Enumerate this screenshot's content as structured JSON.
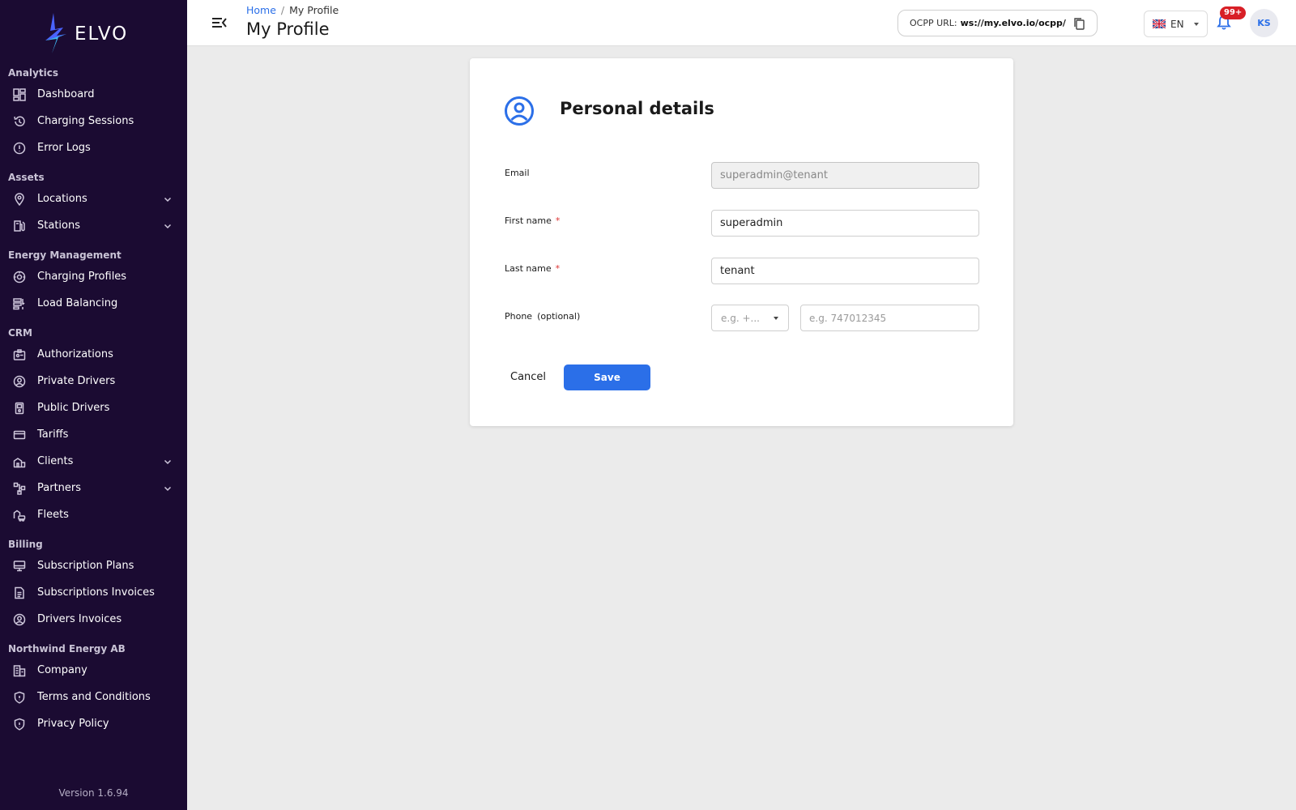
{
  "brand": {
    "name": "ELVO",
    "accent": "#2b6fe8",
    "sidebar_bg": "#1b0b32"
  },
  "sidebar": {
    "sections": [
      {
        "title": "Analytics",
        "items": [
          {
            "label": "Dashboard",
            "icon": "dashboard-icon",
            "expandable": false
          },
          {
            "label": "Charging Sessions",
            "icon": "history-icon",
            "expandable": false
          },
          {
            "label": "Error Logs",
            "icon": "alert-circle-icon",
            "expandable": false
          }
        ]
      },
      {
        "title": "Assets",
        "items": [
          {
            "label": "Locations",
            "icon": "map-pin-icon",
            "expandable": true
          },
          {
            "label": "Stations",
            "icon": "station-icon",
            "expandable": true
          }
        ]
      },
      {
        "title": "Energy Management",
        "items": [
          {
            "label": "Charging Profiles",
            "icon": "gauge-icon",
            "expandable": false
          },
          {
            "label": "Load Balancing",
            "icon": "balance-icon",
            "expandable": false
          }
        ]
      },
      {
        "title": "CRM",
        "items": [
          {
            "label": "Authorizations",
            "icon": "badge-icon",
            "expandable": false
          },
          {
            "label": "Private Drivers",
            "icon": "user-circle-icon",
            "expandable": false
          },
          {
            "label": "Public Drivers",
            "icon": "device-icon",
            "expandable": false
          },
          {
            "label": "Tariffs",
            "icon": "card-icon",
            "expandable": false
          },
          {
            "label": "Clients",
            "icon": "building-icon",
            "expandable": true
          },
          {
            "label": "Partners",
            "icon": "network-icon",
            "expandable": true
          },
          {
            "label": "Fleets",
            "icon": "fleet-icon",
            "expandable": false
          }
        ]
      },
      {
        "title": "Billing",
        "items": [
          {
            "label": "Subscription Plans",
            "icon": "monitor-icon",
            "expandable": false
          },
          {
            "label": "Subscriptions Invoices",
            "icon": "document-icon",
            "expandable": false
          },
          {
            "label": "Drivers Invoices",
            "icon": "user-circle-icon",
            "expandable": false
          }
        ]
      },
      {
        "title": "Northwind Energy AB",
        "items": [
          {
            "label": "Company",
            "icon": "office-icon",
            "expandable": false
          },
          {
            "label": "Terms and Conditions",
            "icon": "shield-icon",
            "expandable": false
          },
          {
            "label": "Privacy Policy",
            "icon": "shield-icon",
            "expandable": false
          }
        ]
      }
    ],
    "version": "Version 1.6.94"
  },
  "header": {
    "breadcrumb": {
      "home": "Home",
      "separator": "/",
      "current": "My Profile"
    },
    "title": "My Profile",
    "ocpp_label": "OCPP URL:",
    "ocpp_url": "ws://my.elvo.io/ocpp/",
    "language": "EN",
    "notification_count": "99+",
    "avatar_initials": "KS"
  },
  "form": {
    "title": "Personal details",
    "email_label": "Email",
    "email_value": "superadmin@tenant",
    "first_name_label": "First name",
    "first_name_value": "superadmin",
    "last_name_label": "Last name",
    "last_name_value": "tenant",
    "required_mark": "*",
    "phone_label": "Phone",
    "phone_optional": "(optional)",
    "country_code_placeholder": "e.g. +...",
    "phone_placeholder": "e.g. 747012345",
    "cancel_label": "Cancel",
    "save_label": "Save"
  }
}
